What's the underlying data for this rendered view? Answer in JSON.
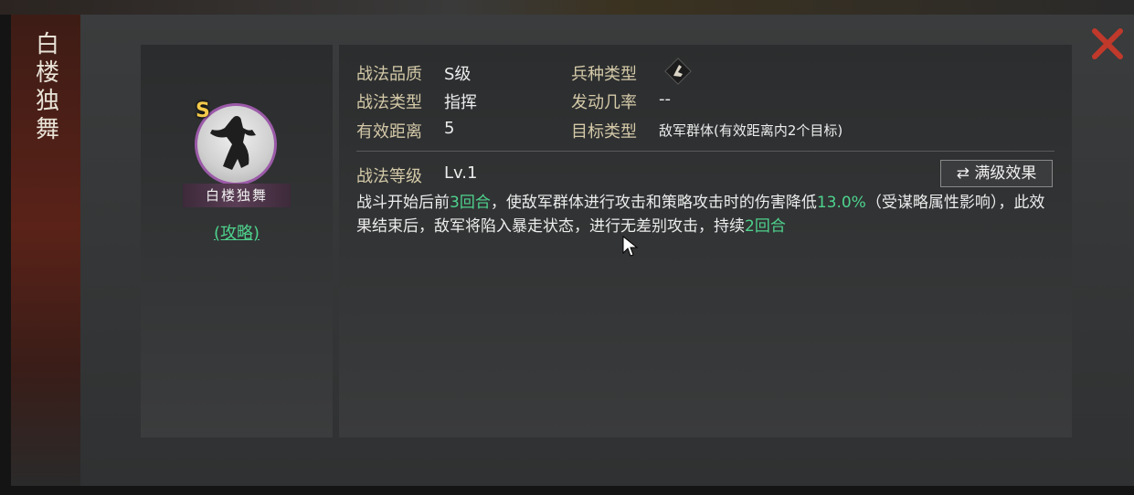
{
  "skill": {
    "name_vertical": "白楼独舞",
    "name_ribbon": "白楼独舞",
    "grade_badge": "S",
    "guide_link": "(攻略)"
  },
  "attributes": {
    "quality_label": "战法品质",
    "quality_value": "S级",
    "type_label": "战法类型",
    "type_value": "指挥",
    "range_label": "有效距离",
    "range_value": "5",
    "troop_label": "兵种类型",
    "troop_icon": "troop-type-icon",
    "rate_label": "发动几率",
    "rate_value": "--",
    "target_label": "目标类型",
    "target_value": "敌军群体(有效距离内2个目标)"
  },
  "level": {
    "label": "战法等级",
    "value": "Lv.1",
    "max_effect_button": "满级效果",
    "max_effect_icon": "swap-arrows-icon"
  },
  "description": {
    "part1": "战斗开始后前",
    "hl1": "3回合",
    "part2": "，使敌军群体进行攻击和策略攻击时的伤害降低",
    "hl2": "13.0%",
    "part3": "（受谋略属性影响），此效果结束后，敌军将陷入暴走状态，进行无差别攻击，持续",
    "hl3": "2回合"
  },
  "colors": {
    "highlight": "#4ed38e",
    "label": "#d4c9a8",
    "close": "#c0392b",
    "badge": "#f2c94c",
    "avatar_ring": "#9b5aa8"
  }
}
